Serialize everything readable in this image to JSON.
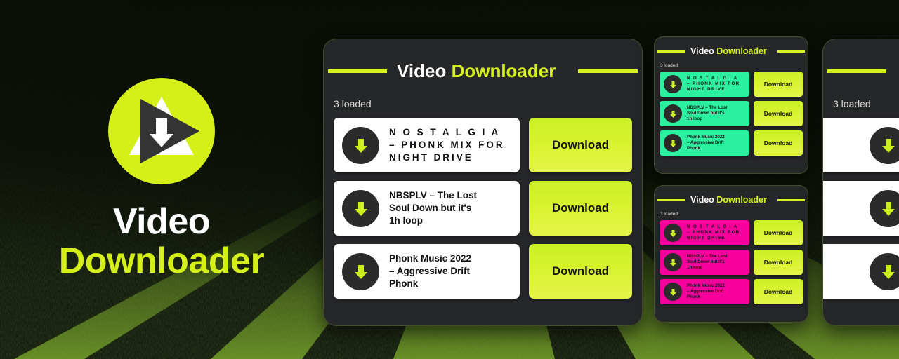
{
  "brand": {
    "logo_icon": "video-download-play-logo",
    "line1": "Video",
    "line2": "Downloader"
  },
  "colors": {
    "accent_lime": "#D7F221",
    "panel_bg": "#262729",
    "row_white": "#FFFFFF",
    "row_green": "#2BF0A0",
    "row_magenta": "#F5009B",
    "icon_circle": "#2B2B2B",
    "background_dark": "#0C1207"
  },
  "app": {
    "title_part1": "Video",
    "title_part2": "Downloader",
    "loaded_label": "3 loaded",
    "download_button_label": "Download",
    "download_icon": "download-arrow-icon",
    "items": [
      {
        "title": "N O S T A L G I A\n–  PHONK MIX FOR NIGHT DRIVE",
        "title_line1": "N O S T A L G I A",
        "title_line2": "–  PHONK MIX FOR",
        "title_line3": "NIGHT DRIVE",
        "spaced": true
      },
      {
        "title": "NBSPLV – The Lost Soul Down but it's 1h loop",
        "title_line1": "NBSPLV – The Lost",
        "title_line2": "Soul Down but it's",
        "title_line3": "1h loop",
        "spaced": false
      },
      {
        "title": "Phonk Music 2022 – Aggressive Drift Phonk",
        "title_line1": "Phonk Music 2022",
        "title_line2": "– Aggressive Drift",
        "title_line3": "Phonk",
        "spaced": false
      }
    ]
  },
  "panels": [
    {
      "id": "main",
      "theme": "white",
      "label": "Video Downloader main screen"
    },
    {
      "id": "green",
      "theme": "green",
      "label": "Video Downloader green theme"
    },
    {
      "id": "magenta",
      "theme": "magenta",
      "label": "Video Downloader magenta theme"
    },
    {
      "id": "crop",
      "theme": "white",
      "label": "Video Downloader partial screen"
    }
  ]
}
